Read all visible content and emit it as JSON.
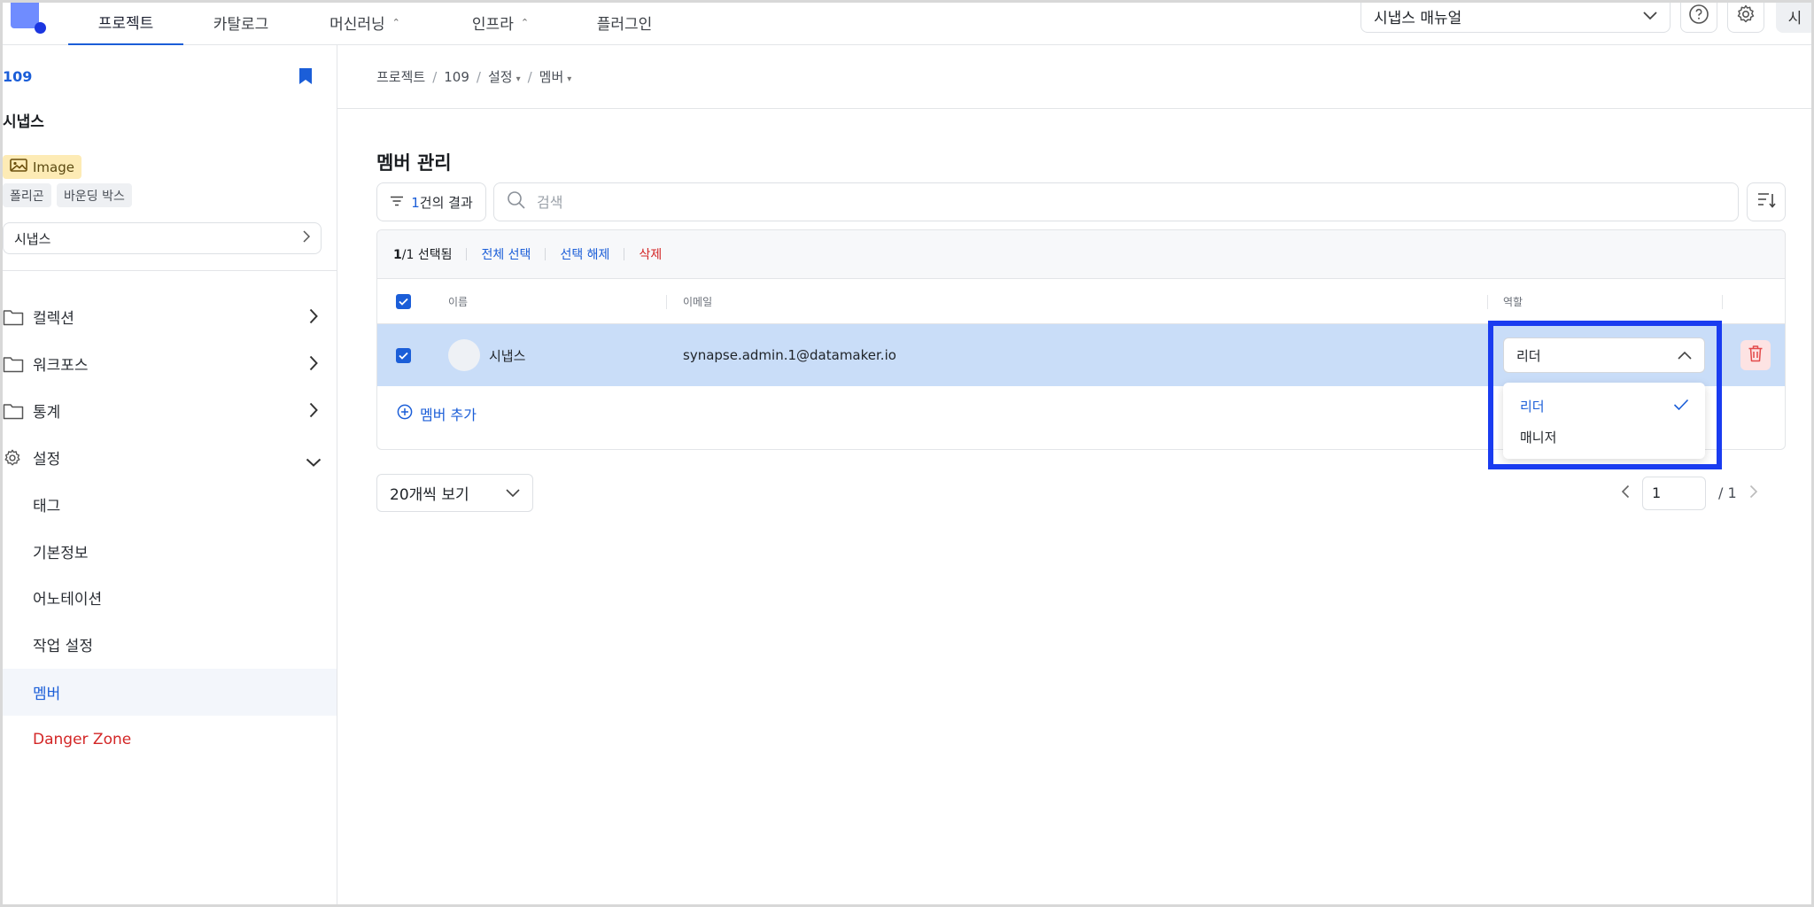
{
  "topnav": {
    "tabs": [
      {
        "label": "프로젝트",
        "active": true
      },
      {
        "label": "카탈로그"
      },
      {
        "label": "머신러닝",
        "has_toggle": true
      },
      {
        "label": "인프라",
        "has_toggle": true
      },
      {
        "label": "플러그인"
      }
    ],
    "manual_select": "시냅스 매뉴얼",
    "user_initial": "시"
  },
  "sidebar": {
    "project_id": "109",
    "project_name": "시냅스",
    "type_badge": "Image",
    "tags": [
      "폴리곤",
      "바운딩 박스"
    ],
    "project_select": "시냅스",
    "menu": [
      {
        "label": "컬렉션",
        "icon": "folder-icon"
      },
      {
        "label": "워크포스",
        "icon": "folder-icon"
      },
      {
        "label": "통계",
        "icon": "folder-icon"
      },
      {
        "label": "설정",
        "icon": "gear-icon",
        "expanded": true
      }
    ],
    "settings_items": [
      {
        "label": "태그"
      },
      {
        "label": "기본정보"
      },
      {
        "label": "어노테이션"
      },
      {
        "label": "작업 설정"
      },
      {
        "label": "멤버",
        "active": true
      },
      {
        "label": "Danger Zone",
        "danger": true
      }
    ]
  },
  "breadcrumb": [
    "프로젝트",
    "109",
    "설정",
    "멤버"
  ],
  "main": {
    "title": "멤버 관리",
    "filter_count": "1",
    "filter_suffix": "건의 결과",
    "search_placeholder": "검색",
    "selection": {
      "count_bold": "1",
      "count_rest": "/1 선택됨",
      "select_all": "전체 선택",
      "deselect": "선택 해제",
      "delete": "삭제"
    },
    "columns": {
      "name": "이름",
      "email": "이메일",
      "role": "역할"
    },
    "rows": [
      {
        "name": "시냅스",
        "email": "synapse.admin.1@datamaker.io",
        "role": "리더",
        "checked": true
      }
    ],
    "add_member": "멤버 추가",
    "role_options": [
      {
        "label": "리더",
        "selected": true
      },
      {
        "label": "매니저"
      }
    ],
    "page_size": "20개씩 보기",
    "pagination": {
      "current": "1",
      "total": "/ 1"
    }
  },
  "colors": {
    "accent": "#1b5ed8",
    "selected_row": "#c9ddf8",
    "danger": "#d32626",
    "highlight_box": "#1a3cf0"
  }
}
